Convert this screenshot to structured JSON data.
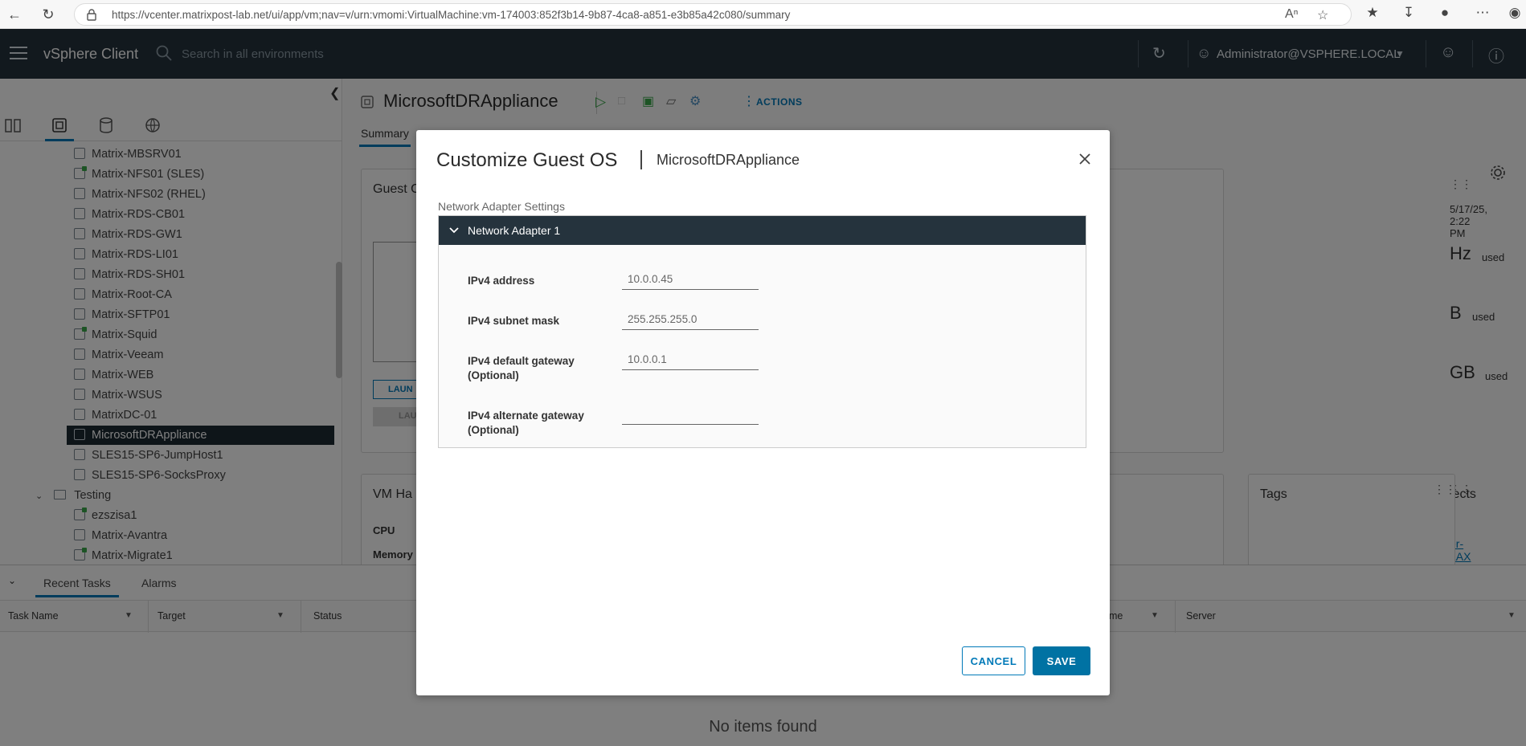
{
  "browser": {
    "url": "https://vcenter.matrixpost-lab.net/ui/app/vm;nav=v/urn:vmomi:VirtualMachine:vm-174003:852f3b14-9b87-4ca8-a851-e3b85a42c080/summary"
  },
  "header": {
    "brand": "vSphere Client",
    "search_placeholder": "Search in all environments",
    "user": "Administrator@VSPHERE.LOCAL"
  },
  "tree": {
    "items": [
      {
        "label": "Matrix-MBSRV01",
        "on": false
      },
      {
        "label": "Matrix-NFS01 (SLES)",
        "on": true
      },
      {
        "label": "Matrix-NFS02 (RHEL)",
        "on": false
      },
      {
        "label": "Matrix-RDS-CB01",
        "on": false
      },
      {
        "label": "Matrix-RDS-GW1",
        "on": false
      },
      {
        "label": "Matrix-RDS-LI01",
        "on": false
      },
      {
        "label": "Matrix-RDS-SH01",
        "on": false
      },
      {
        "label": "Matrix-Root-CA",
        "on": false
      },
      {
        "label": "Matrix-SFTP01",
        "on": false
      },
      {
        "label": "Matrix-Squid",
        "on": true
      },
      {
        "label": "Matrix-Veeam",
        "on": false
      },
      {
        "label": "Matrix-WEB",
        "on": false
      },
      {
        "label": "Matrix-WSUS",
        "on": false
      },
      {
        "label": "MatrixDC-01",
        "on": false
      },
      {
        "label": "MicrosoftDRAppliance",
        "on": false
      },
      {
        "label": "SLES15-SP6-JumpHost1",
        "on": false
      },
      {
        "label": "SLES15-SP6-SocksProxy",
        "on": false
      }
    ],
    "folder": "Testing",
    "folder_items": [
      {
        "label": "ezszisa1",
        "on": true
      },
      {
        "label": "Matrix-Avantra",
        "on": false
      },
      {
        "label": "Matrix-Migrate1",
        "on": true
      }
    ]
  },
  "main": {
    "vm_title": "MicrosoftDRAppliance",
    "actions": "ACTIONS",
    "tab_summary": "Summary",
    "guest_card_title": "Guest OS",
    "launch_btn": "LAUN",
    "launch_btn2": "LAU",
    "date_fragment": "5/17/25, 2:22 PM",
    "usage1_value": "Hz",
    "usage2_value": "B",
    "usage3_value": "GB",
    "used": "used",
    "vm_hw_title": "VM Ha",
    "cpu_label": "CPU",
    "memory_label": "Memory",
    "objects_title": "jects",
    "objects_link": "er-LAX",
    "tags_title": "Tags"
  },
  "bottom": {
    "tabs": [
      "Recent Tasks",
      "Alarms"
    ],
    "columns": [
      "Task Name",
      "Target",
      "Status",
      "me",
      "Server"
    ],
    "empty": "No items found"
  },
  "modal": {
    "title": "Customize Guest OS",
    "subtitle": "MicrosoftDRAppliance",
    "section": "Network Adapter Settings",
    "adapter": "Network Adapter 1",
    "fields": [
      {
        "label": "IPv4 address",
        "value": "10.0.0.45"
      },
      {
        "label": "IPv4 subnet mask",
        "value": "255.255.255.0"
      },
      {
        "label": "IPv4 default gateway (Optional)",
        "value": "10.0.0.1"
      },
      {
        "label": "IPv4 alternate gateway (Optional)",
        "value": ""
      }
    ],
    "cancel": "CANCEL",
    "save": "SAVE"
  },
  "colors": {
    "header_bg": "#25333d",
    "accent": "#0079b8",
    "save_btn": "#0072a3",
    "powered_on": "#3aa84a"
  }
}
